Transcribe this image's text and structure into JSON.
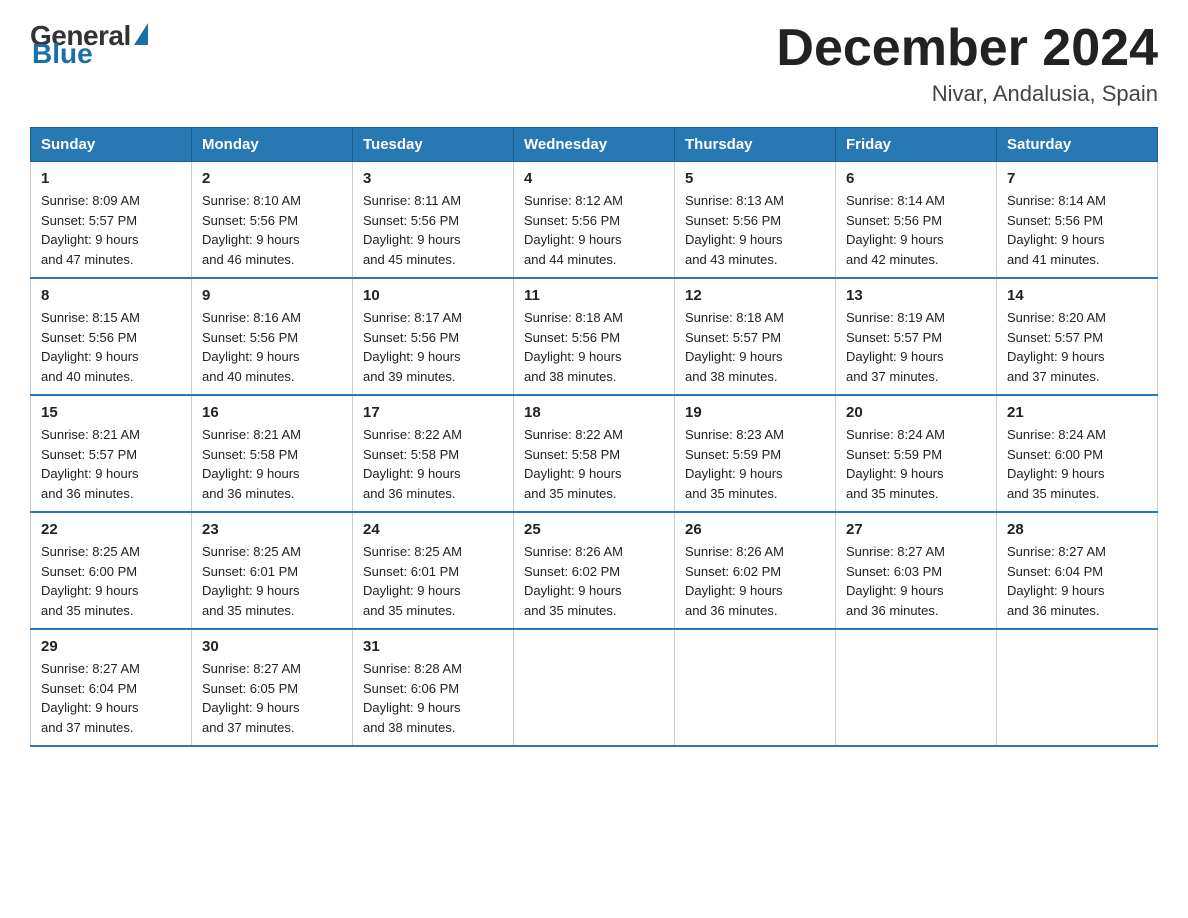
{
  "logo": {
    "general": "General",
    "blue": "Blue"
  },
  "title": "December 2024",
  "location": "Nivar, Andalusia, Spain",
  "days_of_week": [
    "Sunday",
    "Monday",
    "Tuesday",
    "Wednesday",
    "Thursday",
    "Friday",
    "Saturday"
  ],
  "weeks": [
    [
      {
        "day": "1",
        "sunrise": "8:09 AM",
        "sunset": "5:57 PM",
        "daylight": "9 hours and 47 minutes."
      },
      {
        "day": "2",
        "sunrise": "8:10 AM",
        "sunset": "5:56 PM",
        "daylight": "9 hours and 46 minutes."
      },
      {
        "day": "3",
        "sunrise": "8:11 AM",
        "sunset": "5:56 PM",
        "daylight": "9 hours and 45 minutes."
      },
      {
        "day": "4",
        "sunrise": "8:12 AM",
        "sunset": "5:56 PM",
        "daylight": "9 hours and 44 minutes."
      },
      {
        "day": "5",
        "sunrise": "8:13 AM",
        "sunset": "5:56 PM",
        "daylight": "9 hours and 43 minutes."
      },
      {
        "day": "6",
        "sunrise": "8:14 AM",
        "sunset": "5:56 PM",
        "daylight": "9 hours and 42 minutes."
      },
      {
        "day": "7",
        "sunrise": "8:14 AM",
        "sunset": "5:56 PM",
        "daylight": "9 hours and 41 minutes."
      }
    ],
    [
      {
        "day": "8",
        "sunrise": "8:15 AM",
        "sunset": "5:56 PM",
        "daylight": "9 hours and 40 minutes."
      },
      {
        "day": "9",
        "sunrise": "8:16 AM",
        "sunset": "5:56 PM",
        "daylight": "9 hours and 40 minutes."
      },
      {
        "day": "10",
        "sunrise": "8:17 AM",
        "sunset": "5:56 PM",
        "daylight": "9 hours and 39 minutes."
      },
      {
        "day": "11",
        "sunrise": "8:18 AM",
        "sunset": "5:56 PM",
        "daylight": "9 hours and 38 minutes."
      },
      {
        "day": "12",
        "sunrise": "8:18 AM",
        "sunset": "5:57 PM",
        "daylight": "9 hours and 38 minutes."
      },
      {
        "day": "13",
        "sunrise": "8:19 AM",
        "sunset": "5:57 PM",
        "daylight": "9 hours and 37 minutes."
      },
      {
        "day": "14",
        "sunrise": "8:20 AM",
        "sunset": "5:57 PM",
        "daylight": "9 hours and 37 minutes."
      }
    ],
    [
      {
        "day": "15",
        "sunrise": "8:21 AM",
        "sunset": "5:57 PM",
        "daylight": "9 hours and 36 minutes."
      },
      {
        "day": "16",
        "sunrise": "8:21 AM",
        "sunset": "5:58 PM",
        "daylight": "9 hours and 36 minutes."
      },
      {
        "day": "17",
        "sunrise": "8:22 AM",
        "sunset": "5:58 PM",
        "daylight": "9 hours and 36 minutes."
      },
      {
        "day": "18",
        "sunrise": "8:22 AM",
        "sunset": "5:58 PM",
        "daylight": "9 hours and 35 minutes."
      },
      {
        "day": "19",
        "sunrise": "8:23 AM",
        "sunset": "5:59 PM",
        "daylight": "9 hours and 35 minutes."
      },
      {
        "day": "20",
        "sunrise": "8:24 AM",
        "sunset": "5:59 PM",
        "daylight": "9 hours and 35 minutes."
      },
      {
        "day": "21",
        "sunrise": "8:24 AM",
        "sunset": "6:00 PM",
        "daylight": "9 hours and 35 minutes."
      }
    ],
    [
      {
        "day": "22",
        "sunrise": "8:25 AM",
        "sunset": "6:00 PM",
        "daylight": "9 hours and 35 minutes."
      },
      {
        "day": "23",
        "sunrise": "8:25 AM",
        "sunset": "6:01 PM",
        "daylight": "9 hours and 35 minutes."
      },
      {
        "day": "24",
        "sunrise": "8:25 AM",
        "sunset": "6:01 PM",
        "daylight": "9 hours and 35 minutes."
      },
      {
        "day": "25",
        "sunrise": "8:26 AM",
        "sunset": "6:02 PM",
        "daylight": "9 hours and 35 minutes."
      },
      {
        "day": "26",
        "sunrise": "8:26 AM",
        "sunset": "6:02 PM",
        "daylight": "9 hours and 36 minutes."
      },
      {
        "day": "27",
        "sunrise": "8:27 AM",
        "sunset": "6:03 PM",
        "daylight": "9 hours and 36 minutes."
      },
      {
        "day": "28",
        "sunrise": "8:27 AM",
        "sunset": "6:04 PM",
        "daylight": "9 hours and 36 minutes."
      }
    ],
    [
      {
        "day": "29",
        "sunrise": "8:27 AM",
        "sunset": "6:04 PM",
        "daylight": "9 hours and 37 minutes."
      },
      {
        "day": "30",
        "sunrise": "8:27 AM",
        "sunset": "6:05 PM",
        "daylight": "9 hours and 37 minutes."
      },
      {
        "day": "31",
        "sunrise": "8:28 AM",
        "sunset": "6:06 PM",
        "daylight": "9 hours and 38 minutes."
      },
      null,
      null,
      null,
      null
    ]
  ]
}
